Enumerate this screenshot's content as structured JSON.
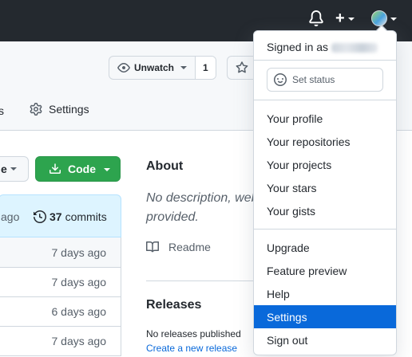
{
  "header": {
    "icons": [
      "bell-icon",
      "plus-icon",
      "avatar"
    ]
  },
  "repo": {
    "unwatch_label": "Unwatch",
    "watch_count": "1",
    "tab_truncated": "s",
    "tab_settings": "Settings"
  },
  "code": {
    "branch_label_truncated": "e",
    "code_button_label": "Code",
    "last_commit_ago": "ago",
    "commit_count": "37",
    "commits_label": "commits",
    "file_rows": [
      "7 days ago",
      "7 days ago",
      "6 days ago",
      "7 days ago"
    ]
  },
  "about": {
    "title": "About",
    "description": "No description, webs provided.",
    "readme_label": "Readme",
    "releases_title": "Releases",
    "no_releases": "No releases published",
    "create_release": "Create a new release"
  },
  "menu": {
    "signed_in_prefix": "Signed in as",
    "set_status": "Set status",
    "group1": [
      "Your profile",
      "Your repositories",
      "Your projects",
      "Your stars",
      "Your gists"
    ],
    "group2": [
      "Upgrade",
      "Feature preview",
      "Help",
      "Settings",
      "Sign out"
    ],
    "active_item": "Settings"
  },
  "colors": {
    "header_bg": "#24292f",
    "code_button": "#2da44e",
    "menu_active": "#0969da"
  }
}
